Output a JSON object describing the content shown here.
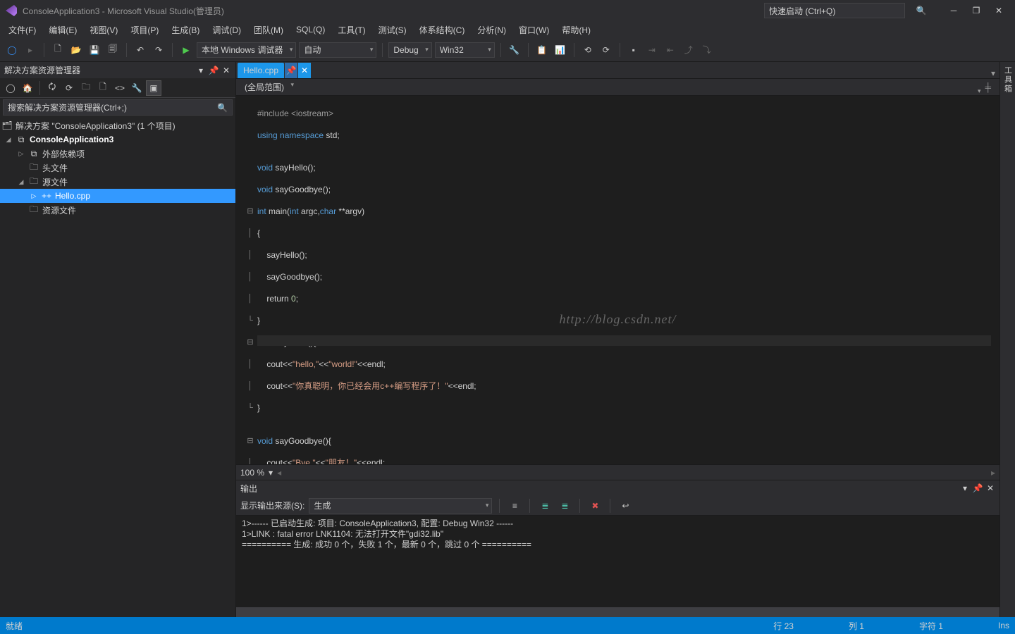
{
  "title": "ConsoleApplication3 - Microsoft Visual Studio(管理员)",
  "quick_launch": "快速启动 (Ctrl+Q)",
  "menu": [
    "文件(F)",
    "编辑(E)",
    "视图(V)",
    "项目(P)",
    "生成(B)",
    "调试(D)",
    "团队(M)",
    "SQL(Q)",
    "工具(T)",
    "测试(S)",
    "体系结构(C)",
    "分析(N)",
    "窗口(W)",
    "帮助(H)"
  ],
  "toolbar": {
    "debugger_label": "本地 Windows 调试器",
    "auto": "自动",
    "config": "Debug",
    "platform": "Win32"
  },
  "solution_explorer": {
    "title": "解决方案资源管理器",
    "search_placeholder": "搜索解决方案资源管理器(Ctrl+;)",
    "solution_label": "解决方案 \"ConsoleApplication3\" (1 个项目)",
    "project": "ConsoleApplication3",
    "nodes": {
      "external": "外部依赖项",
      "headers": "头文件",
      "sources": "源文件",
      "hello": "Hello.cpp",
      "resources": "资源文件"
    }
  },
  "tab": {
    "name": "Hello.cpp"
  },
  "scope": "(全局范围)",
  "code": {
    "l1": "#include <iostream>",
    "l2_a": "using",
    "l2_b": " namespace",
    "l2_c": " std;",
    "l4_a": "void",
    "l4_b": " sayHello();",
    "l5_a": "void",
    "l5_b": " sayGoodbye();",
    "l6_a": "int",
    "l6_b": " main(",
    "l6_c": "int",
    "l6_d": " argc,",
    "l6_e": "char",
    "l6_f": " **argv)",
    "l7": "{",
    "l8": "    sayHello();",
    "l9": "    sayGoodbye();",
    "l10_a": "    return ",
    "l10_b": "0",
    "l10_c": ";",
    "l11": "}",
    "l12_a": "void",
    "l12_b": " sayHello(){",
    "l13_a": "    cout<<",
    "l13_b": "\"hello,\"",
    "l13_c": "<<",
    "l13_d": "\"world!\"",
    "l13_e": "<<endl;",
    "l14_a": "    cout<<",
    "l14_b": "\"你真聪明，你已经会用c++编写程序了！\"",
    "l14_c": "<<endl;",
    "l15": "}",
    "l17_a": "void",
    "l17_b": " sayGoodbye(){",
    "l18_a": "    cout<<",
    "l18_b": "\"Bye,\"",
    "l18_c": "<<",
    "l18_d": "\"朋友！\"",
    "l18_e": "<<endl;",
    "l19": "}"
  },
  "watermark": "http://blog.csdn.net/",
  "zoom": "100 %",
  "output": {
    "title": "输出",
    "from_label": "显示输出来源(S):",
    "from_value": "生成",
    "line1": "1>------ 已启动生成: 项目: ConsoleApplication3, 配置: Debug Win32 ------",
    "line2": "1>LINK : fatal error LNK1104: 无法打开文件\"gdi32.lib\"",
    "line3": "========== 生成: 成功 0 个，失败 1 个，最新 0 个，跳过 0 个 =========="
  },
  "status": {
    "ready": "就绪",
    "line": "行 23",
    "col": "列 1",
    "char": "字符 1",
    "ins": "Ins"
  },
  "right_rail": "工具箱"
}
